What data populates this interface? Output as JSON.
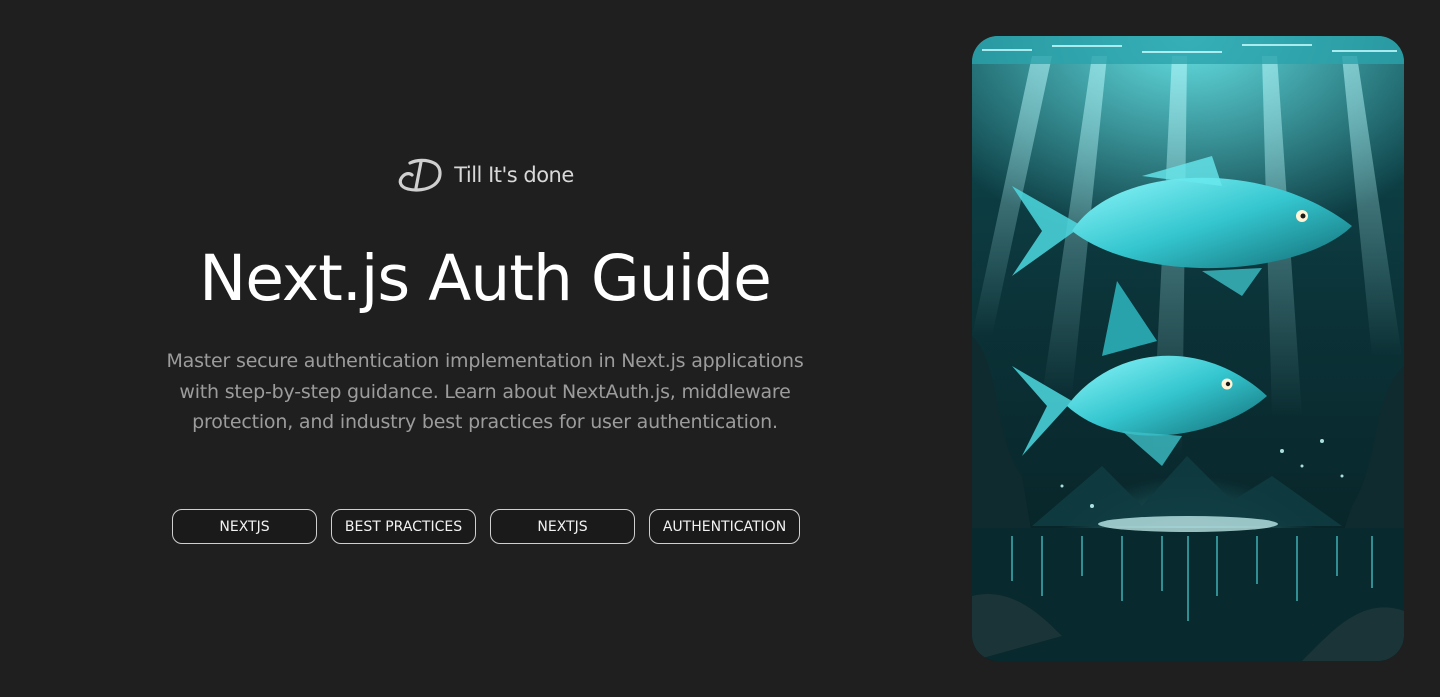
{
  "brand": {
    "logo_icon": "td-monogram-icon",
    "name": "Till It's done"
  },
  "hero": {
    "title": "Next.js Auth Guide",
    "description": "Master secure authentication implementation in Next.js applications with step-by-step guidance. Learn about NextAuth.js, middleware protection, and industry best practices for user authentication."
  },
  "tags": [
    {
      "label": "NEXTJS"
    },
    {
      "label": "BEST PRACTICES"
    },
    {
      "label": "NEXTJS"
    },
    {
      "label": "AUTHENTICATION"
    }
  ],
  "cover_image": {
    "subject": "two glowing cyan fish underwater",
    "colors": {
      "background": "#1f1f1f",
      "accent": "#3fe0e6",
      "deep": "#062226"
    }
  }
}
